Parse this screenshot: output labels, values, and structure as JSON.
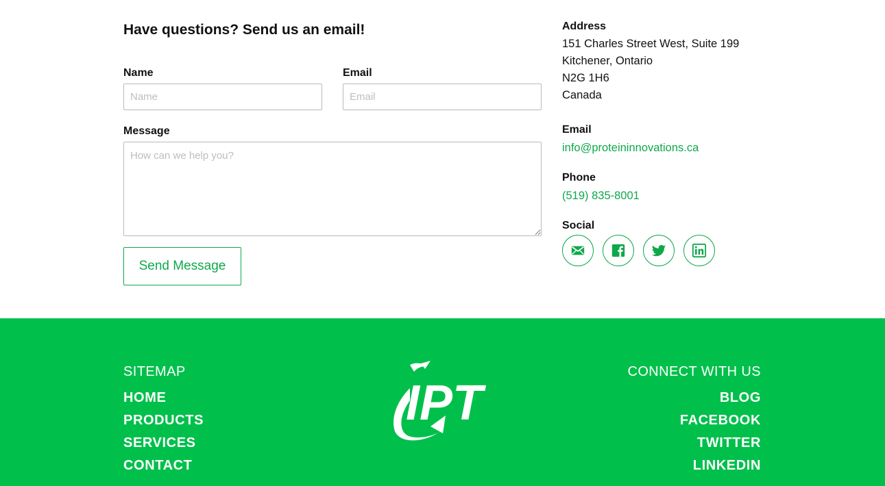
{
  "form": {
    "heading": "Have questions? Send us an email!",
    "name_label": "Name",
    "name_placeholder": "Name",
    "email_label": "Email",
    "email_placeholder": "Email",
    "message_label": "Message",
    "message_placeholder": "How can we help you?",
    "submit_label": "Send Message"
  },
  "info": {
    "address_label": "Address",
    "address_lines": [
      "151 Charles Street West, Suite 199",
      "Kitchener, Ontario",
      "N2G 1H6",
      "Canada"
    ],
    "email_label": "Email",
    "email_value": "info@proteininnovations.ca",
    "phone_label": "Phone",
    "phone_value": "(519) 835-8001",
    "social_label": "Social",
    "social_icons": [
      "mail-icon",
      "facebook-icon",
      "twitter-icon",
      "linkedin-icon"
    ]
  },
  "footer": {
    "sitemap_heading": "SITEMAP",
    "sitemap_links": [
      "HOME",
      "PRODUCTS",
      "SERVICES",
      "CONTACT"
    ],
    "connect_heading": "CONNECT WITH US",
    "connect_links": [
      "BLOG",
      "FACEBOOK",
      "TWITTER",
      "LINKEDIN"
    ],
    "logo_text": "IPT"
  },
  "colors": {
    "accent": "#0fa84b",
    "footer_bg": "#00c04b",
    "text": "#111111"
  }
}
